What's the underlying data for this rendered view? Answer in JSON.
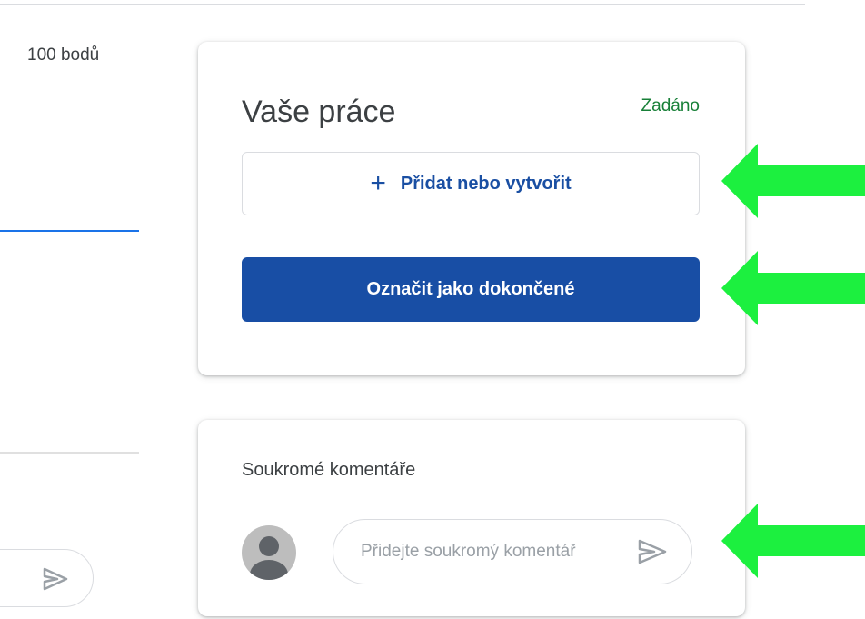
{
  "sidebar": {
    "points": "100 bodů"
  },
  "work": {
    "title": "Vaše práce",
    "status": "Zadáno",
    "add_label": "Přidat nebo vytvořit",
    "done_label": "Označit jako dokončené"
  },
  "comments": {
    "title": "Soukromé komentáře",
    "placeholder": "Přidejte soukromý komentář"
  },
  "icons": {
    "add": "plus-icon",
    "send": "send-icon",
    "avatar": "user-avatar-icon",
    "annotation": "green-arrow-icon"
  },
  "colors": {
    "accent_blue": "#184ea5",
    "status_green": "#188038",
    "annotation_green": "#1cf03f"
  }
}
